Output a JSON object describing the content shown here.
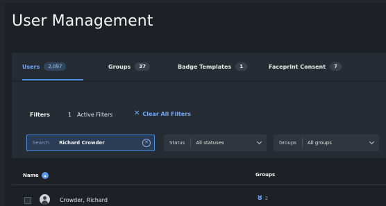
{
  "page": {
    "title": "User Management"
  },
  "tabs": [
    {
      "label": "Users",
      "count": "2,097",
      "active": true
    },
    {
      "label": "Groups",
      "count": "37",
      "active": false
    },
    {
      "label": "Badge Templates",
      "count": "1",
      "active": false
    },
    {
      "label": "Faceprint Consent",
      "count": "7",
      "active": false
    }
  ],
  "filters": {
    "label": "Filters",
    "active_count": "1",
    "active_label": "Active Filters",
    "clear_label": "Clear All Filters"
  },
  "search": {
    "label": "Search",
    "value": "Richard Crowder"
  },
  "status_filter": {
    "label": "Status",
    "value": "All statuses"
  },
  "groups_filter": {
    "label": "Groups",
    "value": "All groups"
  },
  "table": {
    "columns": {
      "name": "Name",
      "groups": "Groups"
    },
    "rows": [
      {
        "name": "Crowder, Richard",
        "groups_count": "2"
      }
    ]
  },
  "colors": {
    "accent": "#4c8fe8",
    "background": "#1d2125"
  }
}
